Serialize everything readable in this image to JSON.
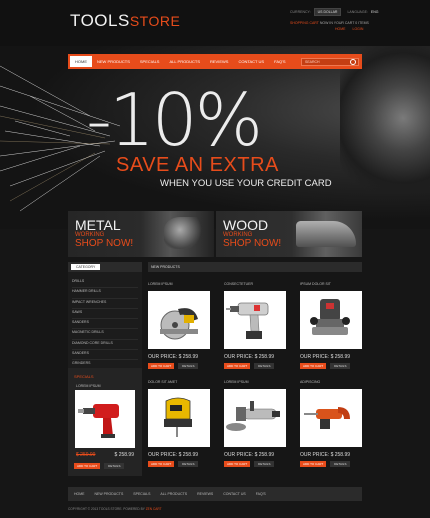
{
  "header": {
    "logo_part1": "TOOLS",
    "logo_part2": "STORE",
    "currency_label": "CURRENCY:",
    "currency_value": "US DOLLAR",
    "language_label": "LANGUAGE:",
    "language_value": "ENG",
    "cart_text": "SHOPPING CART",
    "cart_status": "NOW IN YOUR CART 0 ITEMS",
    "links": [
      "HOME",
      "LOGIN"
    ]
  },
  "nav": {
    "items": [
      "HOME",
      "NEW PRODUCTS",
      "SPECIALS",
      "ALL PRODUCTS",
      "REVIEWS",
      "CONTACT US",
      "FAQ'S"
    ],
    "search_placeholder": "SEARCH"
  },
  "hero": {
    "big": "-10%",
    "save": "SAVE AN EXTRA",
    "when": "WHEN YOU USE  YOUR CREDIT CARD"
  },
  "banners": [
    {
      "title": "METAL",
      "sub": "WORKING",
      "cta": "SHOP NOW!"
    },
    {
      "title": "WOOD",
      "sub": "WORKING",
      "cta": "SHOP NOW!"
    }
  ],
  "sidebar": {
    "category_title": "CATEGORY",
    "categories": [
      "DRILLS",
      "HAMMER DRILLS",
      "IMPACT WRENCHES",
      "SAWS",
      "SANDERS",
      "MAGNETIC DRILLS",
      "DIAMOND CORE DRILLS",
      "SANDERS",
      "GRINDERS"
    ],
    "specials_title": "SPECIALS",
    "special": {
      "name": "LOREM IPSUM",
      "old_price": "$ 259.99",
      "new_price": "$ 258.99",
      "cart_label": "ADD TO CART",
      "details_label": "DETAILS"
    }
  },
  "products": {
    "title": "NEW PRODUCTS",
    "price_label": "OUR PRICE:",
    "cart_label": "ADD TO CART",
    "details_label": "DETAILS",
    "items": [
      {
        "name": "LOREM IPSUM",
        "price": "$ 258.99"
      },
      {
        "name": "CONSECTETUER",
        "price": "$ 258.99"
      },
      {
        "name": "IPSUM DOLOR SIT",
        "price": "$ 258.99"
      },
      {
        "name": "DOLOR SIT AMET",
        "price": "$ 258.99"
      },
      {
        "name": "LOREM IPSUM",
        "price": "$ 258.99"
      },
      {
        "name": "ADIPISCING",
        "price": "$ 258.99"
      }
    ]
  },
  "footer": {
    "links": [
      "HOME",
      "NEW PRODUCTS",
      "SPECIALS",
      "ALL PRODUCTS",
      "REVIEWS",
      "CONTACT US",
      "FAQ'S"
    ],
    "copyright": "COPYRIGHT © 2013 TOOLS STORE. POWERED BY",
    "powered": "ZEN CART"
  },
  "colors": {
    "accent": "#e74c1b",
    "background": "#161616",
    "panel": "#2b2b2b"
  }
}
